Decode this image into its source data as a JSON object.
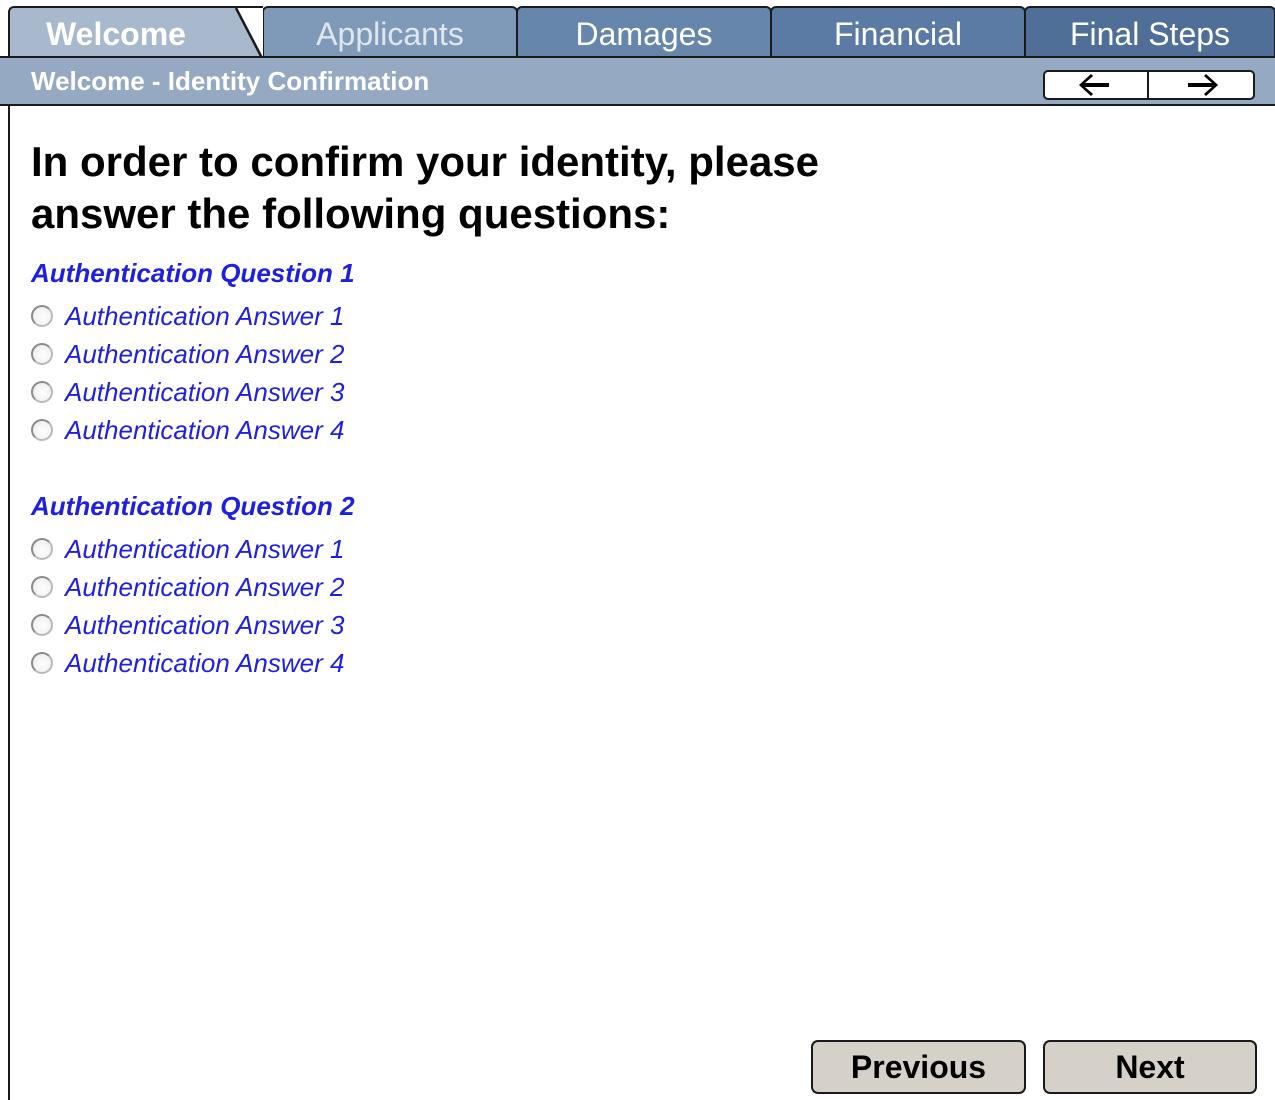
{
  "tabs": [
    {
      "label": "Welcome"
    },
    {
      "label": "Applicants"
    },
    {
      "label": "Damages"
    },
    {
      "label": "Financial"
    },
    {
      "label": "Final Steps"
    }
  ],
  "subheader": {
    "title": "Welcome - Identity Confirmation",
    "back_icon": "arrow-left-icon",
    "forward_icon": "arrow-right-icon"
  },
  "heading": {
    "line1": "In order to confirm your identity, please",
    "line2": "answer the following questions:"
  },
  "questions": [
    {
      "label": "Authentication Question 1",
      "answers": [
        {
          "label": "Authentication Answer 1"
        },
        {
          "label": "Authentication Answer 2"
        },
        {
          "label": "Authentication Answer 3"
        },
        {
          "label": "Authentication Answer 4"
        }
      ]
    },
    {
      "label": "Authentication Question 2",
      "answers": [
        {
          "label": "Authentication Answer 1"
        },
        {
          "label": "Authentication Answer 2"
        },
        {
          "label": "Authentication Answer 3"
        },
        {
          "label": "Authentication Answer 4"
        }
      ]
    }
  ],
  "buttons": {
    "previous": "Previous",
    "next": "Next"
  },
  "colors": {
    "link_blue": "#1f1fe0",
    "tab_active": "#a8b8cd",
    "subbar": "#95a9c2",
    "button_bg": "#d6d1c8"
  }
}
